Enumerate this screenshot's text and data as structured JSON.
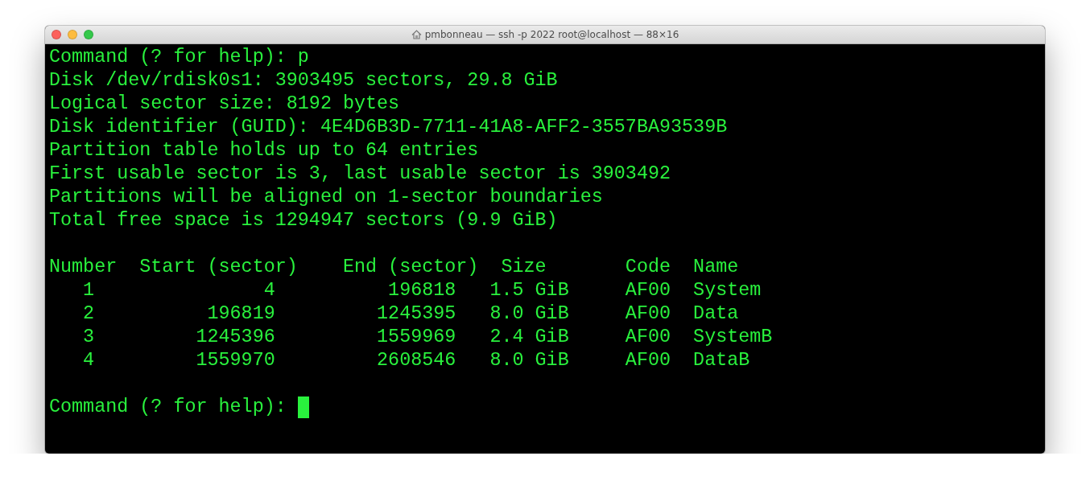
{
  "window": {
    "title": "pmbonneau — ssh -p 2022 root@localhost — 88×16"
  },
  "lines": [
    {
      "kind": "text",
      "text": "Command (? for help): p"
    },
    {
      "kind": "text",
      "text": "Disk /dev/rdisk0s1: 3903495 sectors, 29.8 GiB"
    },
    {
      "kind": "text",
      "text": "Logical sector size: 8192 bytes"
    },
    {
      "kind": "text",
      "text": "Disk identifier (GUID): 4E4D6B3D-7711-41A8-AFF2-3557BA93539B"
    },
    {
      "kind": "text",
      "text": "Partition table holds up to 64 entries"
    },
    {
      "kind": "text",
      "text": "First usable sector is 3, last usable sector is 3903492"
    },
    {
      "kind": "text",
      "text": "Partitions will be aligned on 1-sector boundaries"
    },
    {
      "kind": "text",
      "text": "Total free space is 1294947 sectors (9.9 GiB)"
    },
    {
      "kind": "blank"
    },
    {
      "kind": "text",
      "text": "Number  Start (sector)    End (sector)  Size       Code  Name"
    },
    {
      "kind": "text",
      "text": "   1               4          196818   1.5 GiB     AF00  System"
    },
    {
      "kind": "text",
      "text": "   2          196819         1245395   8.0 GiB     AF00  Data"
    },
    {
      "kind": "text",
      "text": "   3         1245396         1559969   2.4 GiB     AF00  SystemB"
    },
    {
      "kind": "text",
      "text": "   4         1559970         2608546   8.0 GiB     AF00  DataB"
    },
    {
      "kind": "blank"
    },
    {
      "kind": "prompt",
      "text": "Command (? for help):"
    }
  ]
}
